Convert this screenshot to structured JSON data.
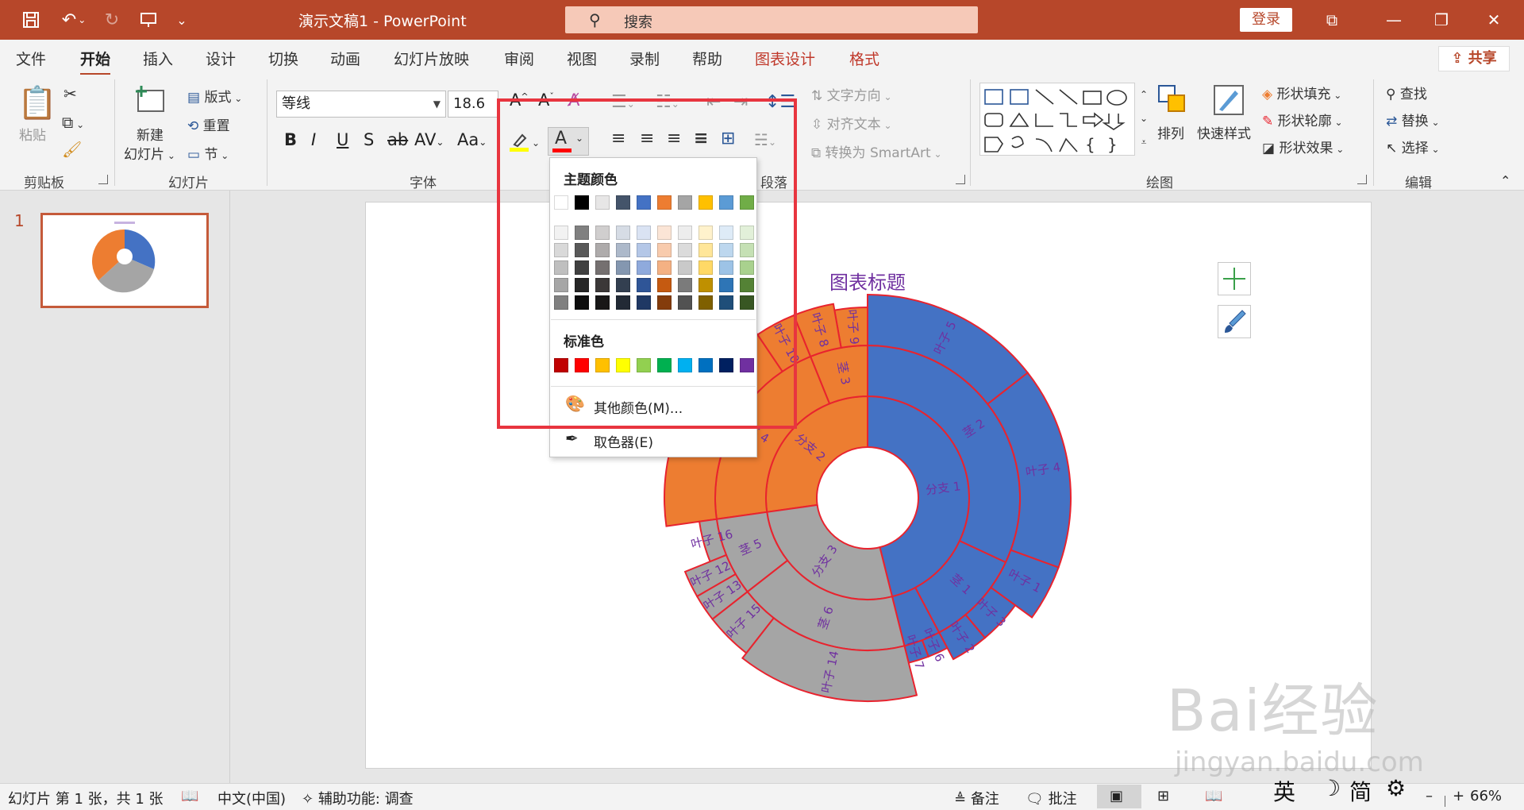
{
  "titlebar": {
    "doc_title": "演示文稿1  -  PowerPoint",
    "search_placeholder": "搜索",
    "login": "登录"
  },
  "menu": {
    "tabs": [
      "文件",
      "开始",
      "插入",
      "设计",
      "切换",
      "动画",
      "幻灯片放映",
      "审阅",
      "视图",
      "录制",
      "帮助",
      "图表设计",
      "格式"
    ],
    "active_tab": "开始",
    "share": "共享"
  },
  "ribbon": {
    "clipboard": {
      "paste": "粘贴",
      "label": "剪贴板"
    },
    "slides": {
      "new_slide_1": "新建",
      "new_slide_2": "幻灯片",
      "layout": "版式",
      "reset": "重置",
      "section": "节",
      "label": "幻灯片"
    },
    "font": {
      "name": "等线",
      "size": "18.6",
      "label": "字体"
    },
    "paragraph": {
      "text_direction": "文字方向",
      "align_text": "对齐文本",
      "smartart": "转换为 SmartArt",
      "label": "段落"
    },
    "drawing": {
      "arrange": "排列",
      "quick_styles": "快速样式",
      "fill": "形状填充",
      "outline": "形状轮廓",
      "effects": "形状效果",
      "label": "绘图"
    },
    "editing": {
      "find": "查找",
      "replace": "替换",
      "select": "选择",
      "label": "编辑"
    }
  },
  "slides_pane": {
    "slide_number": "1"
  },
  "chart": {
    "title": "图表标题",
    "center_labels": [
      "分支 1",
      "分支 2",
      "分支 3"
    ],
    "ring2_labels": [
      "茎 2",
      "茎 1",
      "茎 3",
      "茎 4",
      "茎 5",
      "茎 6"
    ],
    "ring3_labels": [
      "叶子 5",
      "叶子 4",
      "叶子 1",
      "叶子 3",
      "叶子 2",
      "叶子 6",
      "叶子 7",
      "叶子 9",
      "叶子 8",
      "叶子 10",
      "叶子 16",
      "叶子 12",
      "叶子 13",
      "叶子 15",
      "叶子 14"
    ]
  },
  "colors": {
    "accent": "#b7472a",
    "branch1": "#4472c4",
    "branch2": "#ed7d31",
    "branch3": "#a5a5a5",
    "outline": "#e8232e",
    "label": "#7030a0"
  },
  "dropdown": {
    "theme_colors": "主题颜色",
    "standard_colors": "标准色",
    "more_colors": "其他颜色(M)...",
    "eyedropper": "取色器(E)",
    "theme_row": [
      "#ffffff",
      "#000000",
      "#e7e6e6",
      "#44546a",
      "#4472c4",
      "#ed7d31",
      "#a5a5a5",
      "#ffc000",
      "#5b9bd5",
      "#70ad47"
    ],
    "shade_columns": [
      [
        "#f2f2f2",
        "#d9d9d9",
        "#bfbfbf",
        "#a6a6a6",
        "#808080"
      ],
      [
        "#808080",
        "#595959",
        "#404040",
        "#262626",
        "#0d0d0d"
      ],
      [
        "#d0cece",
        "#aeabab",
        "#757070",
        "#3b3838",
        "#181717"
      ],
      [
        "#d6dce5",
        "#adb9ca",
        "#8497b0",
        "#333f50",
        "#222a35"
      ],
      [
        "#dae3f3",
        "#b4c7e7",
        "#8faadc",
        "#2f5597",
        "#1f3864"
      ],
      [
        "#fbe5d6",
        "#f8cbad",
        "#f4b183",
        "#c55a11",
        "#843c0c"
      ],
      [
        "#ededed",
        "#dbdbdb",
        "#c9c9c9",
        "#7b7b7b",
        "#525252"
      ],
      [
        "#fff2cc",
        "#ffe699",
        "#ffd966",
        "#bf9000",
        "#7f6000"
      ],
      [
        "#deebf7",
        "#bdd7ee",
        "#9dc3e6",
        "#2e75b6",
        "#1f4e79"
      ],
      [
        "#e2f0d9",
        "#c5e0b4",
        "#a9d18e",
        "#548235",
        "#385723"
      ]
    ],
    "standard_row": [
      "#c00000",
      "#ff0000",
      "#ffc000",
      "#ffff00",
      "#92d050",
      "#00b050",
      "#00b0f0",
      "#0070c0",
      "#002060",
      "#7030a0"
    ]
  },
  "statusbar": {
    "slide_info": "幻灯片 第 1 张，共 1 张",
    "language": "中文(中国)",
    "accessibility": "辅助功能: 调查",
    "notes": "备注",
    "comments": "批注",
    "zoom": "66%",
    "ime_mode": "英",
    "ime_script": "简"
  },
  "watermark": {
    "brand": "Bai经验",
    "url": "jingyan.baidu.com"
  }
}
